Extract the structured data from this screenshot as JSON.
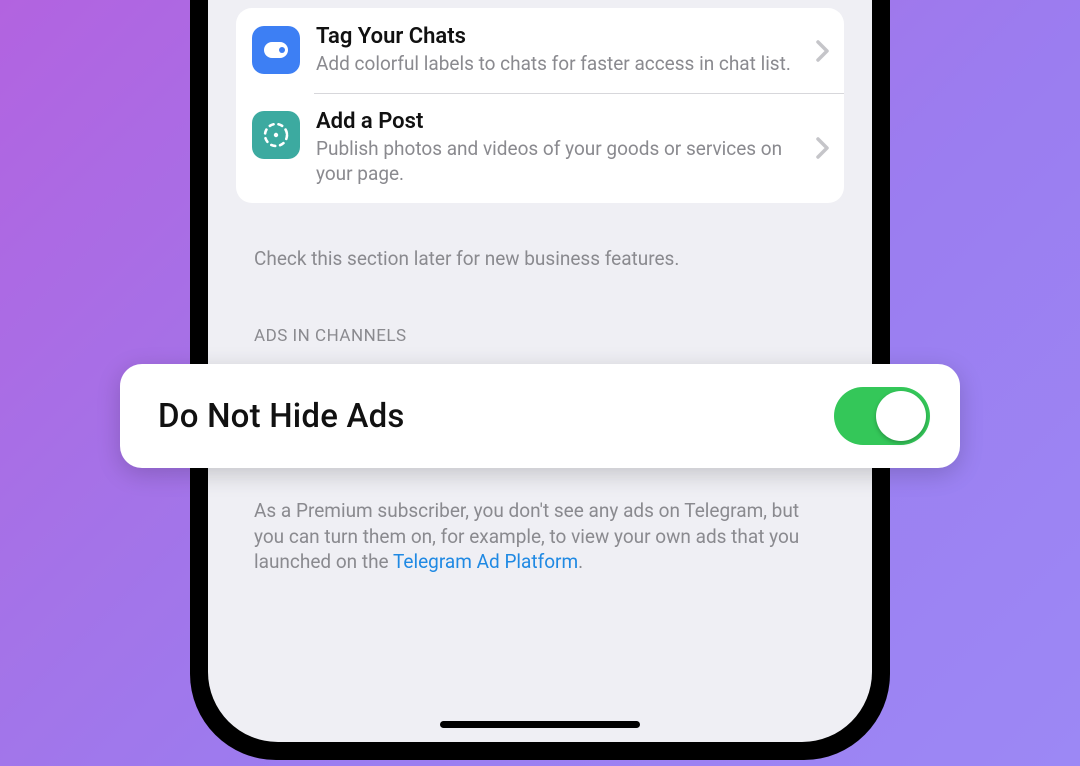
{
  "list": {
    "items": [
      {
        "title": "Tag Your Chats",
        "desc": "Add colorful labels to chats for faster access in chat list."
      },
      {
        "title": "Add a Post",
        "desc": "Publish photos and videos of your goods or services on your page."
      }
    ],
    "footer": "Check this section later for new business features."
  },
  "ads": {
    "header": "ADS IN CHANNELS",
    "toggle_label": "Do Not Hide Ads",
    "toggle_on": true,
    "footer_pre": "As a Premium subscriber, you don't see any ads on Telegram, but you can turn them on, for example, to view your own ads that you launched on the ",
    "footer_link": "Telegram Ad Platform",
    "footer_post": "."
  }
}
